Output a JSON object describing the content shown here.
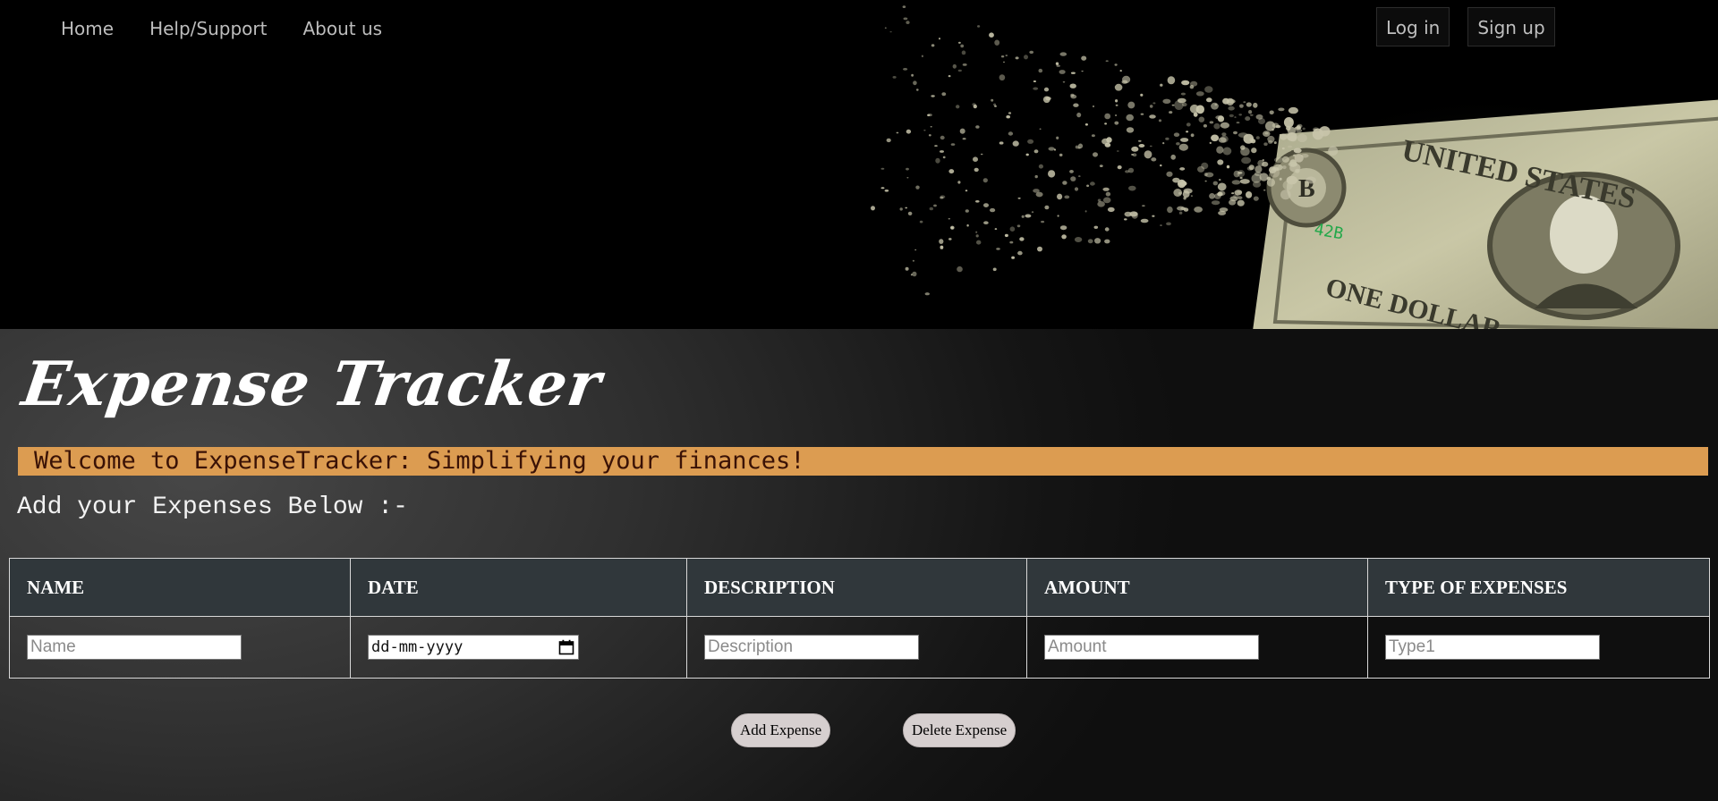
{
  "nav": {
    "items": [
      {
        "label": "Home"
      },
      {
        "label": "Help/Support"
      },
      {
        "label": "About us"
      }
    ],
    "login_label": "Log in",
    "signup_label": "Sign up"
  },
  "hero": {
    "image": "dollar-bill-disintegrating"
  },
  "main": {
    "title": "Expense Tracker",
    "banner": "Welcome to ExpenseTracker: Simplifying your finances!",
    "subtitle": "Add your Expenses Below :-"
  },
  "table": {
    "headers": [
      "NAME",
      "DATE",
      "DESCRIPTION",
      "AMOUNT",
      "TYPE OF EXPENSES"
    ],
    "inputs": {
      "name_placeholder": "Name",
      "date_value": "dd-mm-yyyy",
      "description_placeholder": "Description",
      "amount_placeholder": "Amount",
      "type_placeholder": "Type1"
    }
  },
  "actions": {
    "add_label": "Add Expense",
    "delete_label": "Delete Expense"
  },
  "colors": {
    "banner_bg": "#dc9c51",
    "banner_text": "#3a1206",
    "header_bg": "#30373b",
    "button_bg": "#d6cfcf"
  }
}
